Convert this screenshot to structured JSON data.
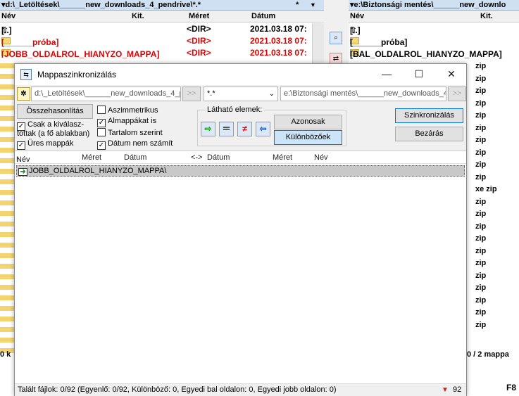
{
  "left_panel": {
    "path": "d:\\_Letöltések\\______new_downloads_4_pendrive\\*.*",
    "star": "*",
    "dropdown": "▼",
    "columns": {
      "name": "Név",
      "ext": "Kit.",
      "size": "Méret",
      "date": "Dátum"
    },
    "rows": [
      {
        "name": "[..]",
        "size": "<DIR>",
        "date": "2021.03.18 07:",
        "red": false
      },
      {
        "name": "[______próba]",
        "size": "<DIR>",
        "date": "2021.03.18 07:",
        "red": true
      },
      {
        "name": "[JOBB_OLDALROL_HIANYZO_MAPPA]",
        "size": "<DIR>",
        "date": "2021.03.18 07:",
        "red": true
      }
    ],
    "status": "0 k"
  },
  "right_panel": {
    "path": "e:\\Biztonsági mentés\\______new_downlo",
    "columns": {
      "name": "Név",
      "ext": "Kit."
    },
    "rows": [
      {
        "name": "[..]"
      },
      {
        "name": "[______próba]",
        "red": false
      },
      {
        "name": "[BAL_OLDALROL_HIANYZO_MAPPA]"
      }
    ],
    "zip_items": [
      "zip",
      "zip",
      "zip",
      "zip",
      "zip",
      "zip",
      "zip",
      "zip",
      "zip",
      "zip",
      "xe zip",
      "zip",
      "zip",
      "zip",
      "zip",
      "zip",
      "zip",
      "zip",
      "zip",
      "zip",
      "zip",
      "zip"
    ],
    "status": "0 / 2 mappa",
    "fkey": "F8"
  },
  "dialog": {
    "title": "Mappaszinkronizálás",
    "left_path": "d:\\_Letöltések\\______new_downloads_4_pe",
    "filter": "*.*",
    "right_path": "e:\\Biztonsági mentés\\______new_downloads_4_",
    "compare_button": "Összehasonlítás",
    "sync_button": "Szinkronizálás",
    "close_button": "Bezárás",
    "options": {
      "selected_only": {
        "label": "Csak a kiválasz-",
        "label2": "tottak (a fő ablakban)",
        "checked": true
      },
      "empty_dirs": {
        "label": "Üres mappák",
        "checked": true
      },
      "asymmetric": {
        "label": "Aszimmetrikus",
        "checked": false
      },
      "subdirs": {
        "label": "Almappákat is",
        "checked": true
      },
      "by_content": {
        "label": "Tartalom szerint",
        "checked": false
      },
      "ignore_date": {
        "label": "Dátum nem számít",
        "checked": true
      }
    },
    "visible_label": "Látható elemek:",
    "same_button": "Azonosak",
    "different_button": "Különbözőek",
    "list_columns": {
      "name_left": "Név",
      "size_left": "Méret",
      "date_left": "Dátum",
      "arrow": "<->",
      "date_right": "Dátum",
      "size_right": "Méret",
      "name_right": "Név"
    },
    "list_rows": [
      {
        "name": "JOBB_OLDALROL_HIANYZO_MAPPA\\"
      }
    ],
    "status": "Talált fájlok: 0/92  (Egyenlő: 0/92, Különböző: 0, Egyedi bal oldalon: 0, Egyedi jobb oldalon: 0)",
    "status_count": "92",
    "colors": {
      "copy_right": "#1a9e1a",
      "copy_left": "#1a5fcf",
      "unequal": "#e00000",
      "accent": "#0078d7"
    }
  }
}
